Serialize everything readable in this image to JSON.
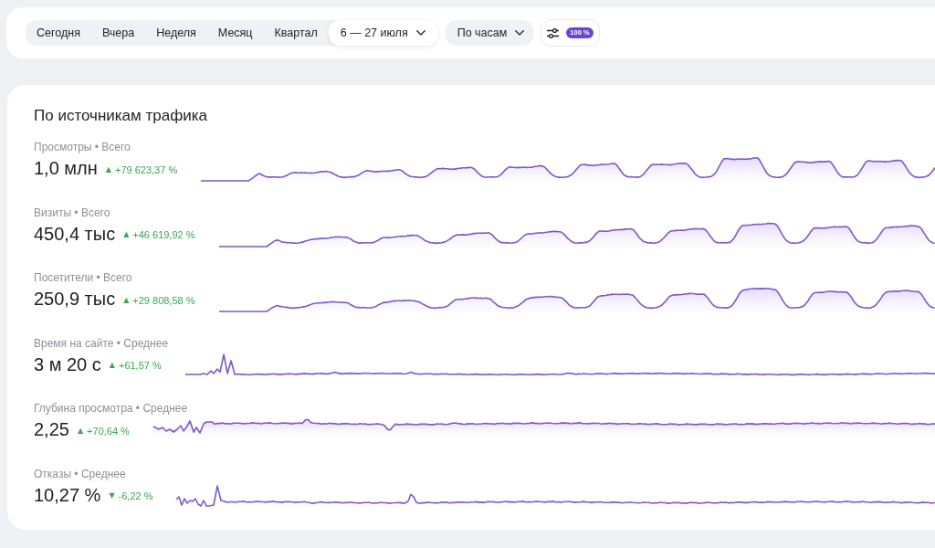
{
  "toolbar": {
    "periods": [
      {
        "kind": "tab",
        "label": "Сегодня",
        "selected": false
      },
      {
        "kind": "tab",
        "label": "Вчера",
        "selected": false
      },
      {
        "kind": "tab",
        "label": "Неделя",
        "selected": false
      },
      {
        "kind": "tab",
        "label": "Месяц",
        "selected": false
      },
      {
        "kind": "tab",
        "label": "Квартал",
        "selected": false
      },
      {
        "kind": "range",
        "label": "6 — 27 июля",
        "selected": true
      }
    ],
    "grouping": {
      "label": "По часам"
    },
    "filters": {
      "badge": "100 %"
    }
  },
  "card": {
    "title": "По источникам трафика",
    "metrics": [
      {
        "label": "Просмотры • Всего",
        "value": "1,0 млн",
        "arrow": "▲",
        "change": "+79 623,37 %"
      },
      {
        "label": "Визиты • Всего",
        "value": "450,4 тыс",
        "arrow": "▲",
        "change": "+46 619,92 %"
      },
      {
        "label": "Посетители • Всего",
        "value": "250,9 тыс",
        "arrow": "▲",
        "change": "+29 808,58 %"
      },
      {
        "label": "Время на сайте • Среднее",
        "value": "3 м 20 с",
        "arrow": "▲",
        "change": "+61,57 %"
      },
      {
        "label": "Глубина просмотра • Среднее",
        "value": "2,25",
        "arrow": "▲",
        "change": "+70,64 %"
      },
      {
        "label": "Отказы • Среднее",
        "value": "10,27 %",
        "arrow": "▼",
        "change": "-6,22 %"
      }
    ]
  }
}
